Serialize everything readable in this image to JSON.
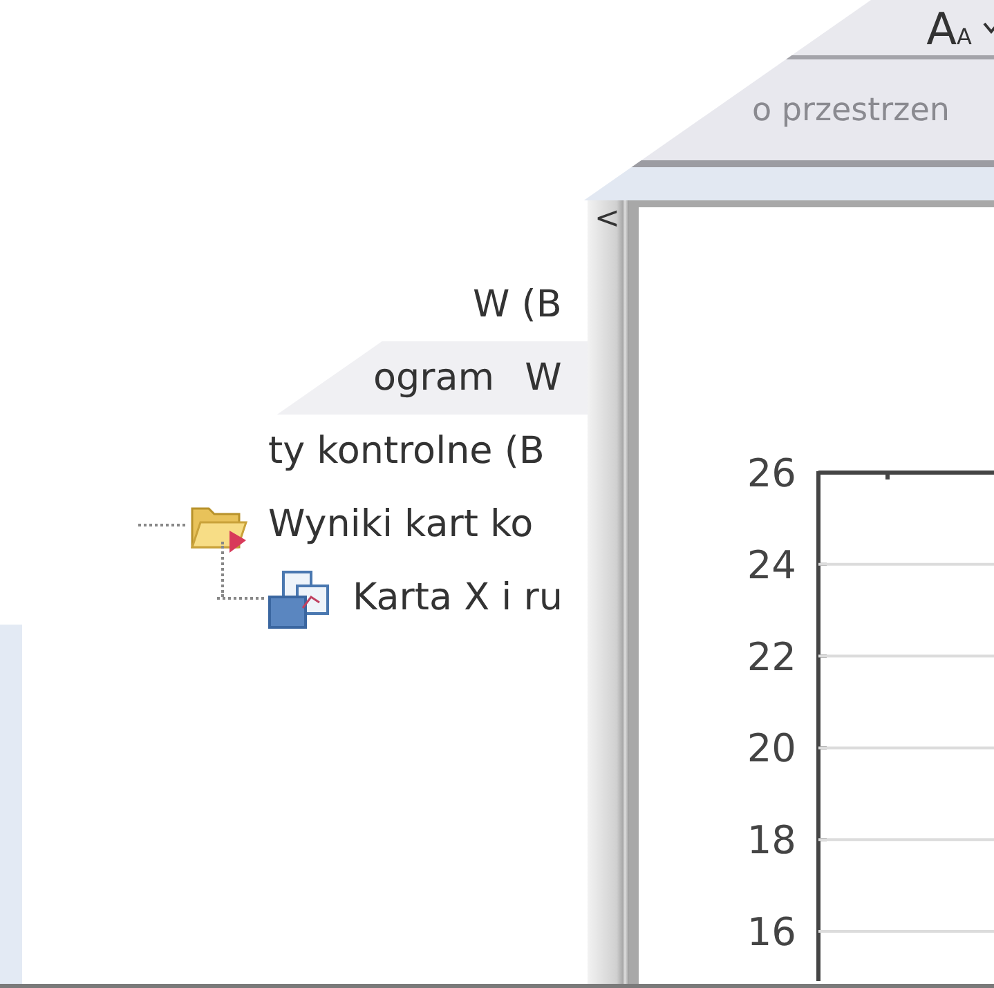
{
  "toolbar": {
    "font_button": {
      "label": "AA"
    }
  },
  "search": {
    "value": "o przestrzen"
  },
  "splitter": {
    "glyph": "<"
  },
  "tree": {
    "items": [
      {
        "label": "W (B",
        "selected": false
      },
      {
        "label": "ogram",
        "extra": "W",
        "selected": true
      },
      {
        "label": "ty kontrolne (B",
        "selected": false,
        "children": [
          {
            "label": "Wyniki kart ko",
            "kind": "folder",
            "selected": false,
            "children": [
              {
                "label": "Karta X i ru",
                "kind": "chart",
                "selected": false
              }
            ]
          }
        ]
      }
    ]
  },
  "chart": {
    "y_ticks": [
      "26",
      "24",
      "22",
      "20",
      "18",
      "16"
    ]
  }
}
